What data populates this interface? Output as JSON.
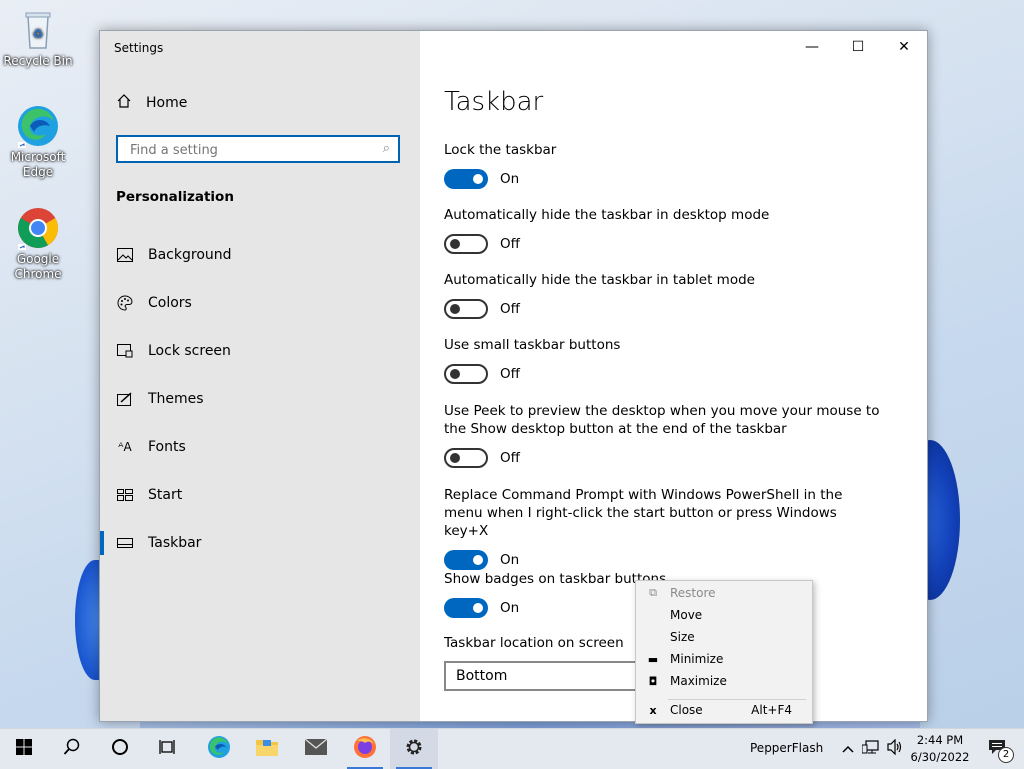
{
  "desktop": {
    "icons": [
      {
        "label": "Recycle Bin"
      },
      {
        "label": "Microsoft Edge"
      },
      {
        "label": "Google Chrome"
      }
    ]
  },
  "window": {
    "title": "Settings",
    "controls": {
      "minimize": "—",
      "maximize": "☐",
      "close": "✕"
    }
  },
  "sidebar": {
    "home_label": "Home",
    "search_placeholder": "Find a setting",
    "section_title": "Personalization",
    "items": [
      {
        "label": "Background",
        "icon": "background-icon"
      },
      {
        "label": "Colors",
        "icon": "palette-icon"
      },
      {
        "label": "Lock screen",
        "icon": "lock-screen-icon"
      },
      {
        "label": "Themes",
        "icon": "themes-icon"
      },
      {
        "label": "Fonts",
        "icon": "fonts-icon"
      },
      {
        "label": "Start",
        "icon": "start-icon"
      },
      {
        "label": "Taskbar",
        "icon": "taskbar-icon",
        "active": true
      }
    ]
  },
  "content": {
    "title": "Taskbar",
    "settings": [
      {
        "label": "Lock the taskbar",
        "state": "On"
      },
      {
        "label": "Automatically hide the taskbar in desktop mode",
        "state": "Off"
      },
      {
        "label": "Automatically hide the taskbar in tablet mode",
        "state": "Off"
      },
      {
        "label": "Use small taskbar buttons",
        "state": "Off"
      },
      {
        "label": "Use Peek to preview the desktop when you move your mouse to the Show desktop button at the end of the taskbar",
        "state": "Off"
      },
      {
        "label": "Replace Command Prompt with Windows PowerShell in the menu when I right-click the start button or press Windows key+X",
        "state": "On"
      },
      {
        "label": "Show badges on taskbar buttons",
        "state": "On"
      }
    ],
    "location_label": "Taskbar location on screen",
    "location_value": "Bottom"
  },
  "context_menu": {
    "items": [
      {
        "label": "Restore",
        "icon": "restore-icon",
        "disabled": true
      },
      {
        "label": "Move"
      },
      {
        "label": "Size"
      },
      {
        "label": "Minimize",
        "icon": "minimize-icon"
      },
      {
        "label": "Maximize",
        "icon": "maximize-icon"
      },
      {
        "label": "Close",
        "icon": "close-icon",
        "accel": "Alt+F4"
      }
    ]
  },
  "taskbar": {
    "tray_app": "PepperFlash",
    "time": "2:44 PM",
    "date": "6/30/2022",
    "notification_count": "2"
  }
}
